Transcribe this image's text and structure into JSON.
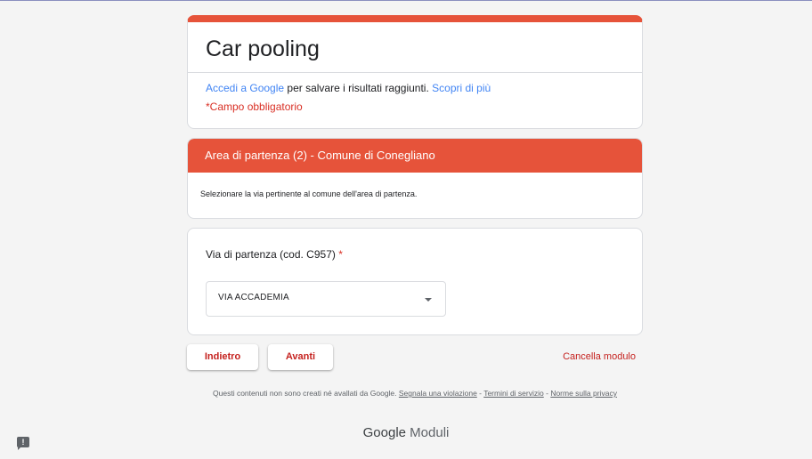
{
  "form": {
    "title": "Car pooling",
    "signin": {
      "link_text": "Accedi a Google",
      "middle_text": " per salvare i risultati raggiunti. ",
      "learn_more": "Scopri di più"
    },
    "required_note": "*Campo obbligatorio"
  },
  "section": {
    "header": "Area di partenza (2) - Comune di Conegliano",
    "description": "Selezionare la via pertinente al comune dell'area di partenza."
  },
  "question": {
    "label": "Via di partenza (cod. C957)",
    "required_mark": "*",
    "selected_value": "VIA ACCADEMIA"
  },
  "navigation": {
    "back_label": "Indietro",
    "next_label": "Avanti",
    "clear_label": "Cancella modulo"
  },
  "footer": {
    "disclaimer": "Questi contenuti non sono creati né avallati da Google. ",
    "report_link": "Segnala una violazione",
    "sep1": " - ",
    "terms_link": "Termini di servizio",
    "sep2": " - ",
    "privacy_link": "Norme sulla privacy",
    "brand_google": "Google",
    "brand_product": " Moduli"
  },
  "feedback": {
    "icon_glyph": "!"
  },
  "colors": {
    "accent": "#e6533a",
    "required": "#d93025",
    "link": "#4285f4",
    "button_text": "#c5221f"
  }
}
